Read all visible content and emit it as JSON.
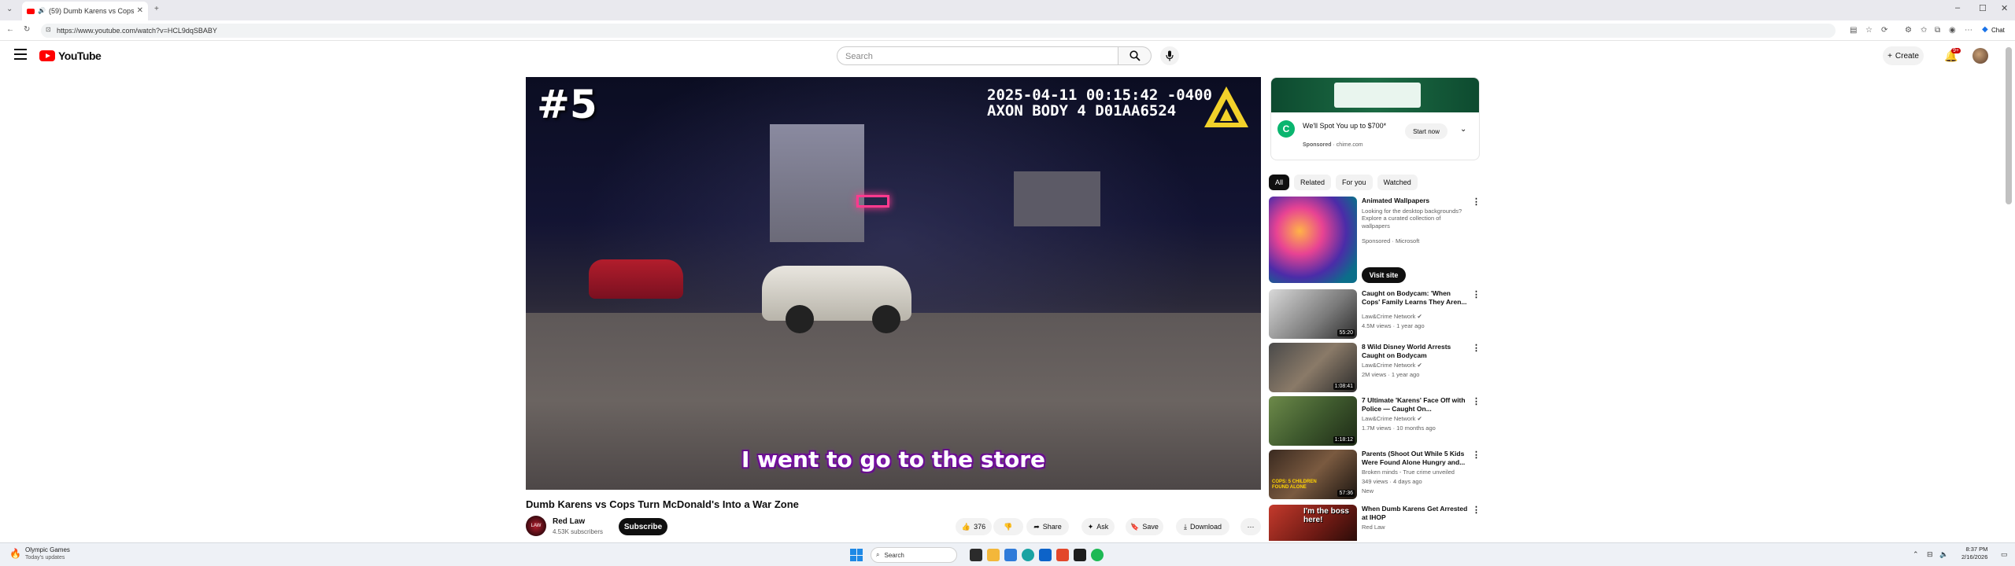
{
  "browser": {
    "tab_title": "(59) Dumb Karens vs Cops T",
    "tab_notification": "(59)",
    "url": "https://www.youtube.com/watch?v=HCL9dqSBABY"
  },
  "youtube": {
    "logo_text": "YouTube",
    "search_placeholder": "Search",
    "create_label": "Create",
    "notification_count": "9+"
  },
  "video": {
    "overlay_rank": "#5",
    "overlay_timestamp": "2025-04-11 00:15:42 -0400\nAXON BODY 4 D01AA6524",
    "overlay_subtitle": "I went to go to the store",
    "title": "Dumb Karens vs Cops Turn McDonald's Into a War Zone",
    "channel_name": "Red Law",
    "channel_subs": "4.53K subscribers",
    "channel_avatar_text": "LAW",
    "subscribe_label": "Subscribe",
    "like_count": "376",
    "share_label": "Share",
    "ask_label": "Ask",
    "save_label": "Save",
    "download_label": "Download"
  },
  "ad": {
    "headline": "We'll Spot You up to $700*",
    "sponsor": "Sponsored · chime.com",
    "sponsor_label": "Sponsored",
    "sponsor_domain": "chime.com",
    "cta": "Start now",
    "logo_letter": "C"
  },
  "chips": [
    "All",
    "Related",
    "For you",
    "Watched"
  ],
  "recommendations": [
    {
      "title": "Animated Wallpapers",
      "channel": "Looking for the desktop backgrounds? Explore a curated collection of wallpapers",
      "meta": "Sponsored · Microsoft",
      "duration": "",
      "cta": "Visit site"
    },
    {
      "title": "Caught on Bodycam: 'When Cops' Family Learns They Aren...",
      "channel": "Law&Crime Network",
      "meta": "4.5M views · 1 year ago",
      "duration": "55:20"
    },
    {
      "title": "8 Wild Disney World Arrests Caught on Bodycam",
      "channel": "Law&Crime Network",
      "meta": "2M views · 1 year ago",
      "duration": "1:08:41"
    },
    {
      "title": "7 Ultimate 'Karens' Face Off with Police — Caught On...",
      "channel": "Law&Crime Network",
      "meta": "1.7M views · 10 months ago",
      "duration": "1:18:12"
    },
    {
      "title": "Parents (Shoot Out While 5 Kids Were Found Alone Hungry and...",
      "channel": "Broken minds - True crime unveiled",
      "meta": "349 views · 4 days ago",
      "badge": "New",
      "duration": "57:36",
      "thumb_text": "COPS: 5 CHILDREN FOUND ALONE"
    },
    {
      "title": "When Dumb Karens Get Arrested at IHOP",
      "channel": "Red Law",
      "meta": "",
      "duration": "",
      "thumb_text": "I'm the boss here!"
    }
  ],
  "taskbar": {
    "news_title": "Olympic Games",
    "news_sub": "Today's updates",
    "search_label": "Search",
    "time": "8:37 PM",
    "date": "2/16/2026"
  },
  "colors": {
    "brand_red": "#ff0000",
    "subscribe_bg": "#0f0f0f",
    "subtitle_glow": "#9a1bd6",
    "ad_green": "#0ab56f"
  }
}
